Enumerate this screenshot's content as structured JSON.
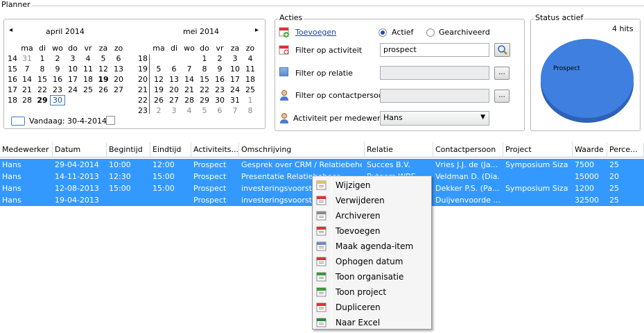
{
  "planner": {
    "title": "Planner"
  },
  "calendar": {
    "prev_icon": "◂",
    "next_icon": "▸",
    "months": [
      {
        "title": "april 2014",
        "weekdays": [
          "ma",
          "di",
          "wo",
          "do",
          "vr",
          "za",
          "zo"
        ],
        "weeks": [
          "14",
          "15",
          "16",
          "17",
          "18"
        ],
        "rows": [
          [
            {
              "d": "31",
              "g": true
            },
            {
              "d": "1"
            },
            {
              "d": "2"
            },
            {
              "d": "3"
            },
            {
              "d": "4"
            },
            {
              "d": "5"
            },
            {
              "d": "6"
            }
          ],
          [
            {
              "d": "7"
            },
            {
              "d": "8"
            },
            {
              "d": "9"
            },
            {
              "d": "10"
            },
            {
              "d": "11"
            },
            {
              "d": "12"
            },
            {
              "d": "13"
            }
          ],
          [
            {
              "d": "14"
            },
            {
              "d": "15"
            },
            {
              "d": "16"
            },
            {
              "d": "17"
            },
            {
              "d": "18"
            },
            {
              "d": "19",
              "b": true
            },
            {
              "d": "20"
            }
          ],
          [
            {
              "d": "21"
            },
            {
              "d": "22"
            },
            {
              "d": "23"
            },
            {
              "d": "24"
            },
            {
              "d": "25"
            },
            {
              "d": "26"
            },
            {
              "d": "27"
            }
          ],
          [
            {
              "d": "28"
            },
            {
              "d": "29",
              "b": true
            },
            {
              "d": "30",
              "today": true
            }
          ]
        ]
      },
      {
        "title": "mei 2014",
        "weekdays": [
          "ma",
          "di",
          "wo",
          "do",
          "vr",
          "za",
          "zo"
        ],
        "weeks": [
          "18",
          "19",
          "20",
          "21",
          "22",
          "23"
        ],
        "rows": [
          [
            {
              "d": ""
            },
            {
              "d": ""
            },
            {
              "d": ""
            },
            {
              "d": "1"
            },
            {
              "d": "2"
            },
            {
              "d": "3"
            },
            {
              "d": "4"
            }
          ],
          [
            {
              "d": "5"
            },
            {
              "d": "6"
            },
            {
              "d": "7"
            },
            {
              "d": "8"
            },
            {
              "d": "9"
            },
            {
              "d": "10"
            },
            {
              "d": "11"
            }
          ],
          [
            {
              "d": "12"
            },
            {
              "d": "13"
            },
            {
              "d": "14"
            },
            {
              "d": "15"
            },
            {
              "d": "16"
            },
            {
              "d": "17"
            },
            {
              "d": "18"
            }
          ],
          [
            {
              "d": "19"
            },
            {
              "d": "20"
            },
            {
              "d": "21"
            },
            {
              "d": "22"
            },
            {
              "d": "23"
            },
            {
              "d": "24"
            },
            {
              "d": "25"
            }
          ],
          [
            {
              "d": "26"
            },
            {
              "d": "27"
            },
            {
              "d": "28"
            },
            {
              "d": "29"
            },
            {
              "d": "30"
            },
            {
              "d": "31"
            },
            {
              "d": "1",
              "g": true
            }
          ],
          [
            {
              "d": "2",
              "g": true
            },
            {
              "d": "3",
              "g": true
            },
            {
              "d": "4",
              "g": true
            },
            {
              "d": "5",
              "g": true
            },
            {
              "d": "6",
              "g": true
            },
            {
              "d": "7",
              "g": true
            },
            {
              "d": "8",
              "g": true
            }
          ]
        ]
      }
    ],
    "today_label": "Vandaag: 30-4-2014"
  },
  "actions": {
    "title": "Acties",
    "add_link": "Toevoegen",
    "radio_active": "Actief",
    "radio_archived": "Gearchiveerd",
    "filter_activity_label": "Filter op activiteit",
    "filter_activity_value": "prospect",
    "filter_relation_label": "Filter op relatie",
    "filter_contact_label": "Filter op contactpersoon",
    "employee_label": "Activiteit per medewerker",
    "employee_value": "Hans",
    "ellipsis": "..."
  },
  "status": {
    "title": "Status actief",
    "hits": "4 hits",
    "pie_label": "Prospect",
    "pie_color": "#3e7fe0",
    "chart_data": {
      "type": "pie",
      "categories": [
        "Prospect"
      ],
      "values": [
        4
      ]
    }
  },
  "table": {
    "columns": [
      "Medewerker",
      "Datum",
      "Begintijd",
      "Eindtijd",
      "Activiteits...",
      "Omschrijving",
      "Relatie",
      "Contactpersoon",
      "Project",
      "Waarde",
      "Perce..."
    ],
    "rows": [
      [
        "Hans",
        "29-04-2014",
        "10:00",
        "12:00",
        "Prospect",
        "Gesprek over CRM / Relatiebehe...",
        "Succes B.V.",
        "Vries J.J. de (Ja...",
        "Symposium Siza ...",
        "7500",
        "25"
      ],
      [
        "Hans",
        "14-11-2013",
        "12:30",
        "15:00",
        "Prospect",
        "Presentatie Relatiebeheer",
        "Putgers WBE",
        "Veldman D. (Dia...",
        "",
        "15000",
        "20"
      ],
      [
        "Hans",
        "12-08-2013",
        "15:00",
        "15:00",
        "Prospect",
        "investeringsvoorstel CRM",
        "",
        "Dekker P.S. (Pa...",
        "Symposium Siza ...",
        "1200",
        "25"
      ],
      [
        "Hans",
        "19-04-2013",
        "",
        "",
        "Prospect",
        "investeringsvoorstel CRM",
        "",
        "Duijvenvoorde ...",
        "",
        "32500",
        "25"
      ]
    ]
  },
  "context_menu": {
    "items": [
      {
        "label": "Wijzigen",
        "icon": "edit-icon"
      },
      {
        "label": "Verwijderen",
        "icon": "delete-calendar-icon"
      },
      {
        "label": "Archiveren",
        "icon": "archive-icon"
      },
      {
        "label": "Toevoegen",
        "icon": "add-calendar-icon"
      },
      {
        "label": "Maak agenda-item",
        "icon": "agenda-icon"
      },
      {
        "label": "Ophogen datum",
        "icon": "increment-date-icon"
      },
      {
        "label": "Toon organisatie",
        "icon": "organisation-icon"
      },
      {
        "label": "Toon project",
        "icon": "project-icon"
      },
      {
        "label": "Dupliceren",
        "icon": "duplicate-icon"
      },
      {
        "label": "Naar Excel",
        "icon": "excel-icon"
      }
    ]
  }
}
